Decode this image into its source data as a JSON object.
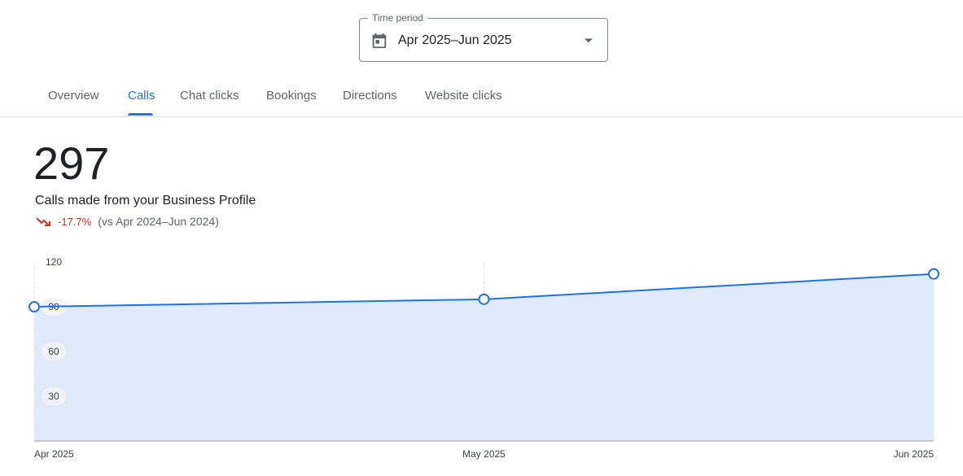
{
  "time_period": {
    "legend": "Time period",
    "value": "Apr 2025–Jun 2025"
  },
  "tabs": [
    {
      "label": "Overview",
      "active": false
    },
    {
      "label": "Calls",
      "active": true
    },
    {
      "label": "Chat clicks",
      "active": false
    },
    {
      "label": "Bookings",
      "active": false
    },
    {
      "label": "Directions",
      "active": false
    },
    {
      "label": "Website clicks",
      "active": false
    }
  ],
  "metric": {
    "value": "297",
    "description": "Calls made from your Business Profile",
    "change": "-17.7%",
    "comparison": "(vs Apr 2024–Jun 2024)"
  },
  "colors": {
    "accent": "#1a73e8",
    "negative": "#d93025",
    "area_fill": "#e1eafc"
  },
  "chart_data": {
    "type": "area",
    "categories": [
      "Apr 2025",
      "May 2025",
      "Jun 2025"
    ],
    "series": [
      {
        "values": [
          90,
          95,
          112
        ]
      }
    ],
    "y_ticks": [
      "30",
      "60",
      "90",
      "120"
    ],
    "ylim": [
      0,
      120
    ],
    "grid": "vertical dashed"
  }
}
